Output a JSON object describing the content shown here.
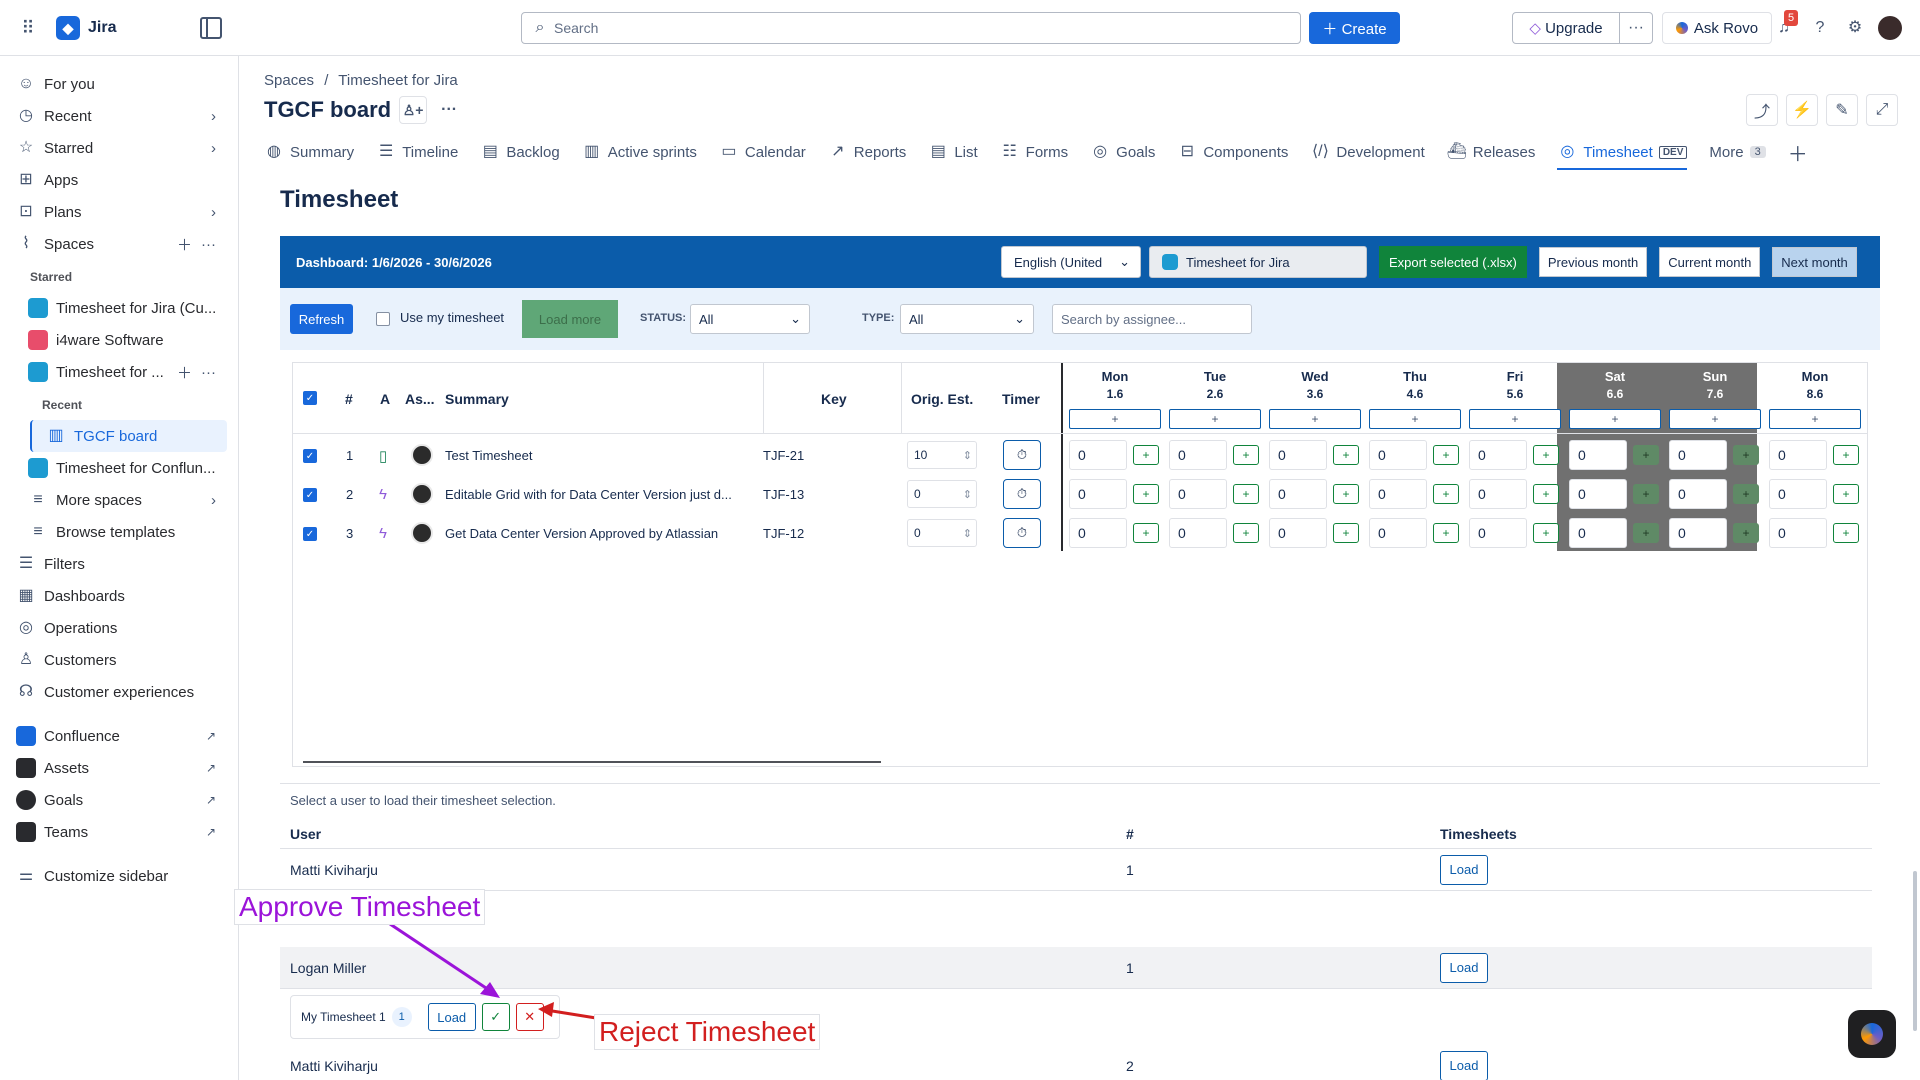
{
  "topbar": {
    "app_name": "Jira",
    "search_placeholder": "Search",
    "create_label": "Create",
    "upgrade_label": "Upgrade",
    "ask_rovo_label": "Ask Rovo",
    "notifications_count": "5"
  },
  "sidebar": {
    "items": [
      {
        "label": "For you"
      },
      {
        "label": "Recent"
      },
      {
        "label": "Starred"
      },
      {
        "label": "Apps"
      },
      {
        "label": "Plans"
      },
      {
        "label": "Spaces"
      }
    ],
    "starred_header": "Starred",
    "starred": [
      {
        "label": "Timesheet for Jira (Cu..."
      },
      {
        "label": "i4ware Software"
      },
      {
        "label": "Timesheet for ..."
      }
    ],
    "recent_header": "Recent",
    "recent_board": "TGCF board",
    "spaces_more": [
      {
        "label": "Timesheet for Conflun..."
      },
      {
        "label": "More spaces"
      },
      {
        "label": "Browse templates"
      }
    ],
    "bottom": [
      {
        "label": "Filters"
      },
      {
        "label": "Dashboards"
      },
      {
        "label": "Operations"
      },
      {
        "label": "Customers"
      },
      {
        "label": "Customer experiences"
      }
    ],
    "apps": [
      {
        "label": "Confluence"
      },
      {
        "label": "Assets"
      },
      {
        "label": "Goals"
      },
      {
        "label": "Teams"
      }
    ],
    "customize": "Customize sidebar"
  },
  "header": {
    "breadcrumb_root": "Spaces",
    "breadcrumb_sep": "/",
    "breadcrumb_space": "Timesheet for Jira",
    "board_title": "TGCF board"
  },
  "tabs": [
    {
      "label": "Summary"
    },
    {
      "label": "Timeline"
    },
    {
      "label": "Backlog"
    },
    {
      "label": "Active sprints"
    },
    {
      "label": "Calendar"
    },
    {
      "label": "Reports"
    },
    {
      "label": "List"
    },
    {
      "label": "Forms"
    },
    {
      "label": "Goals"
    },
    {
      "label": "Components"
    },
    {
      "label": "Development"
    },
    {
      "label": "Releases"
    },
    {
      "label": "Timesheet",
      "tag": "DEV"
    },
    {
      "label": "More",
      "count": "3"
    }
  ],
  "timesheet": {
    "title": "Timesheet",
    "dashboard_range": "Dashboard: 1/6/2026 - 30/6/2026",
    "language": "English (United",
    "project": "Timesheet for Jira",
    "export_label": "Export selected (.xlsx)",
    "prev_month": "Previous month",
    "current_month": "Current month",
    "next_month": "Next month",
    "refresh": "Refresh",
    "use_my_timesheet": "Use my timesheet",
    "load_more": "Load more",
    "status_label": "STATUS:",
    "status_value": "All",
    "type_label": "TYPE:",
    "type_value": "All",
    "assignee_placeholder": "Search by assignee..."
  },
  "grid": {
    "columns": [
      "#",
      "A",
      "As...",
      "Summary",
      "Key",
      "Orig. Est.",
      "Timer"
    ],
    "days": [
      {
        "name": "Mon",
        "date": "1.6"
      },
      {
        "name": "Tue",
        "date": "2.6"
      },
      {
        "name": "Wed",
        "date": "3.6"
      },
      {
        "name": "Thu",
        "date": "4.6"
      },
      {
        "name": "Fri",
        "date": "5.6"
      },
      {
        "name": "Sat",
        "date": "6.6"
      },
      {
        "name": "Sun",
        "date": "7.6"
      },
      {
        "name": "Mon",
        "date": "8.6"
      }
    ],
    "plus": "+",
    "rows": [
      {
        "num": "1",
        "summary": "Test Timesheet",
        "key": "TJF-21",
        "est": "10",
        "hours": [
          "0",
          "0",
          "0",
          "0",
          "0",
          "0",
          "0",
          "0"
        ]
      },
      {
        "num": "2",
        "summary": "Editable Grid with for Data Center Version just d...",
        "key": "TJF-13",
        "est": "0",
        "hours": [
          "0",
          "0",
          "0",
          "0",
          "0",
          "0",
          "0",
          "0"
        ]
      },
      {
        "num": "3",
        "summary": "Get Data Center Version Approved by Atlassian",
        "key": "TJF-12",
        "est": "0",
        "hours": [
          "0",
          "0",
          "0",
          "0",
          "0",
          "0",
          "0",
          "0"
        ]
      }
    ]
  },
  "users": {
    "hint": "Select a user to load their timesheet selection.",
    "col_user": "User",
    "col_count": "#",
    "col_timesheets": "Timesheets",
    "load_label": "Load",
    "rows": [
      {
        "user": "Matti Kiviharju",
        "count": "1"
      },
      {
        "user": "Logan Miller",
        "count": "1"
      },
      {
        "user": "Matti Kiviharju",
        "count": "2"
      }
    ],
    "sub_item": {
      "name": "My Timesheet 1",
      "count": "1",
      "approve": "✓",
      "reject": "✕"
    }
  },
  "annotations": {
    "approve": "Approve Timesheet",
    "reject": "Reject Timesheet",
    "approve_color": "#9b14d9",
    "reject_color": "#d21f1f"
  }
}
